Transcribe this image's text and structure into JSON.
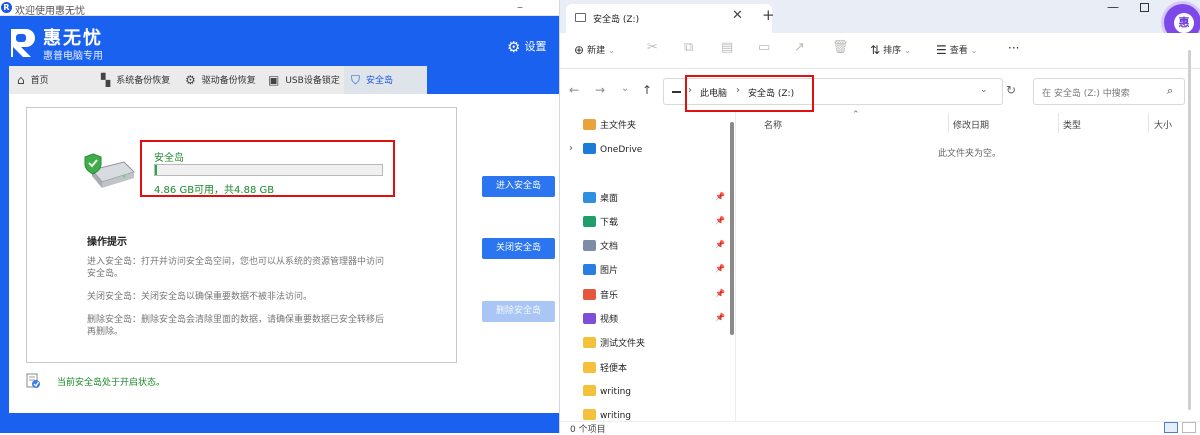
{
  "app": {
    "window_title": "欢迎使用惠无忧",
    "brand": "惠无忧",
    "brand_sub": "惠普电脑专用",
    "settings_label": "设置",
    "tabs": [
      {
        "label": "首页",
        "icon": "home-icon"
      },
      {
        "label": "系统备份恢复",
        "icon": "system-backup-icon"
      },
      {
        "label": "驱动备份恢复",
        "icon": "gear-icon"
      },
      {
        "label": "USB设备锁定",
        "icon": "usb-lock-icon"
      },
      {
        "label": "安全岛",
        "icon": "shield-icon",
        "active": true
      }
    ],
    "drive": {
      "name": "安全岛",
      "capacity_text": "4.86 GB可用，共4.88 GB",
      "used_fraction": 0.004
    },
    "tips": {
      "title": "操作提示",
      "items": [
        "进入安全岛：打开并访问安全岛空间，您也可以从系统的资源管理器中访问安全岛。",
        "关闭安全岛：关闭安全岛以确保重要数据不被非法访问。",
        "删除安全岛：删除安全岛会清除里面的数据，请确保重要数据已安全转移后再删除。"
      ]
    },
    "buttons": {
      "enter": "进入安全岛",
      "close": "关闭安全岛",
      "delete": "删除安全岛"
    },
    "status": "当前安全岛处于开启状态。",
    "colors": {
      "accent": "#1a61f0",
      "success": "#1a8a2a",
      "highlight": "#e01010"
    }
  },
  "explorer": {
    "tab_title": "安全岛 (Z:)",
    "toolbar": {
      "new": "新建",
      "sort": "排序",
      "view": "查看",
      "more": "···"
    },
    "breadcrumb": [
      "此电脑",
      "安全岛 (Z:)"
    ],
    "search_placeholder": "在 安全岛 (Z:) 中搜索",
    "nav": [
      {
        "label": "主文件夹",
        "icon": "home-folder-icon",
        "color": "#e8a33a"
      },
      {
        "label": "OneDrive",
        "icon": "cloud-icon",
        "color": "#1d7bd8"
      },
      {
        "label": "桌面",
        "icon": "desktop-icon",
        "color": "#2f8fe0",
        "pinned": true
      },
      {
        "label": "下载",
        "icon": "download-icon",
        "color": "#1f9e6a",
        "pinned": true
      },
      {
        "label": "文档",
        "icon": "document-icon",
        "color": "#7d8da6",
        "pinned": true
      },
      {
        "label": "图片",
        "icon": "pictures-icon",
        "color": "#2a7de1",
        "pinned": true
      },
      {
        "label": "音乐",
        "icon": "music-icon",
        "color": "#e4573d",
        "pinned": true
      },
      {
        "label": "视频",
        "icon": "video-icon",
        "color": "#7b4fd8",
        "pinned": true
      },
      {
        "label": "测试文件夹",
        "icon": "folder-icon",
        "color": "#f4c13d"
      },
      {
        "label": "轻便本",
        "icon": "folder-icon",
        "color": "#f4c13d"
      },
      {
        "label": "writing",
        "icon": "folder-icon",
        "color": "#f4c13d"
      },
      {
        "label": "writing",
        "icon": "folder-icon",
        "color": "#f4c13d"
      }
    ],
    "columns": [
      "名称",
      "修改日期",
      "类型",
      "大小"
    ],
    "empty_text": "此文件夹为空。",
    "status_count": "0 个项目"
  }
}
